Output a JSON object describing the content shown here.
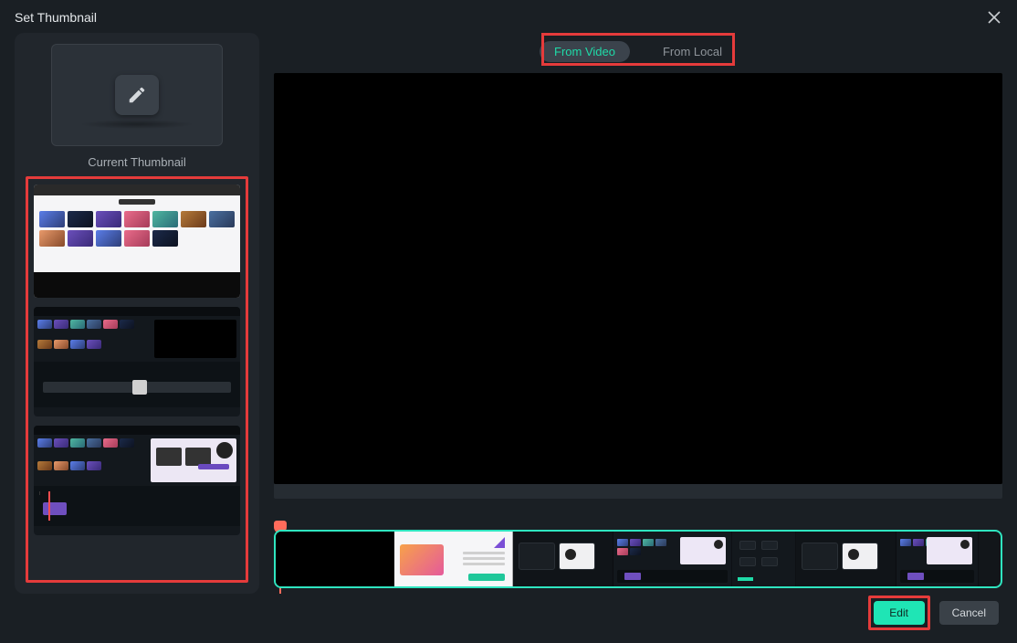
{
  "dialog": {
    "title": "Set Thumbnail",
    "current_label": "Current Thumbnail"
  },
  "tabs": {
    "from_video": "From Video",
    "from_local": "From Local",
    "active": "from_video"
  },
  "buttons": {
    "edit": "Edit",
    "cancel": "Cancel"
  },
  "highlights": {
    "tabs": true,
    "frame_list": true,
    "edit_button": true
  }
}
